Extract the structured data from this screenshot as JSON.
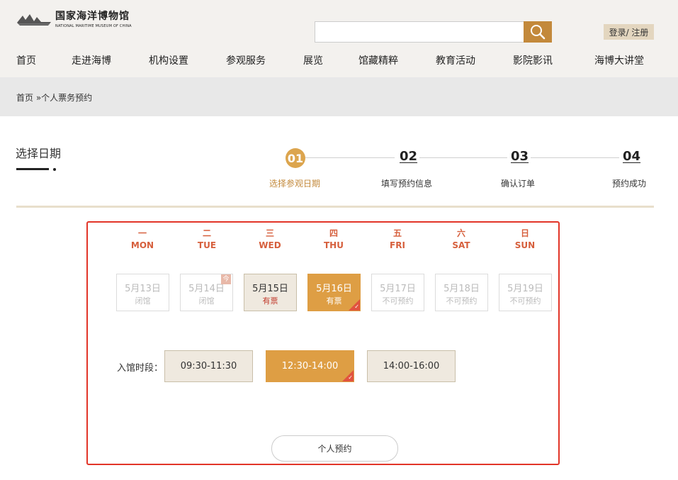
{
  "header": {
    "logo_cn": "国家海洋博物馆",
    "logo_en": "NATIONAL MARITIME MUSEUM OF CHINA",
    "search_placeholder": "",
    "login": "登录/ 注册"
  },
  "nav": [
    "首页",
    "走进海博",
    "机构设置",
    "参观服务",
    "展览",
    "馆藏精粹",
    "教育活动",
    "影院影讯",
    "海博大讲堂"
  ],
  "breadcrumb": "首页 »个人票务预约",
  "page_title": "选择日期",
  "steps": [
    {
      "num": "01",
      "label": "选择参观日期",
      "active": true
    },
    {
      "num": "02",
      "label": "填写预约信息",
      "active": false
    },
    {
      "num": "03",
      "label": "确认订单",
      "active": false
    },
    {
      "num": "04",
      "label": "预约成功",
      "active": false
    }
  ],
  "weekdays": [
    {
      "cn": "一",
      "en": "MON"
    },
    {
      "cn": "二",
      "en": "TUE"
    },
    {
      "cn": "三",
      "en": "WED"
    },
    {
      "cn": "四",
      "en": "THU"
    },
    {
      "cn": "五",
      "en": "FRI"
    },
    {
      "cn": "六",
      "en": "SAT"
    },
    {
      "cn": "日",
      "en": "SUN"
    }
  ],
  "days": [
    {
      "date": "5月13日",
      "status": "闭馆",
      "state": "disabled"
    },
    {
      "date": "5月14日",
      "status": "闭馆",
      "state": "disabled",
      "tag": "今"
    },
    {
      "date": "5月15日",
      "status": "有票",
      "state": "available"
    },
    {
      "date": "5月16日",
      "status": "有票",
      "state": "selected"
    },
    {
      "date": "5月17日",
      "status": "不可预约",
      "state": "disabled"
    },
    {
      "date": "5月18日",
      "status": "不可预约",
      "state": "disabled"
    },
    {
      "date": "5月19日",
      "status": "不可预约",
      "state": "disabled"
    }
  ],
  "time_label": "入馆时段：",
  "slots": [
    {
      "label": "09:30-11:30",
      "selected": false
    },
    {
      "label": "12:30-14:00",
      "selected": true
    },
    {
      "label": "14:00-16:00",
      "selected": false
    }
  ],
  "reserve_button": "个人预约",
  "colors": {
    "accent": "#de9e44",
    "brand": "#c3893b",
    "highlight_border": "#e23528"
  }
}
